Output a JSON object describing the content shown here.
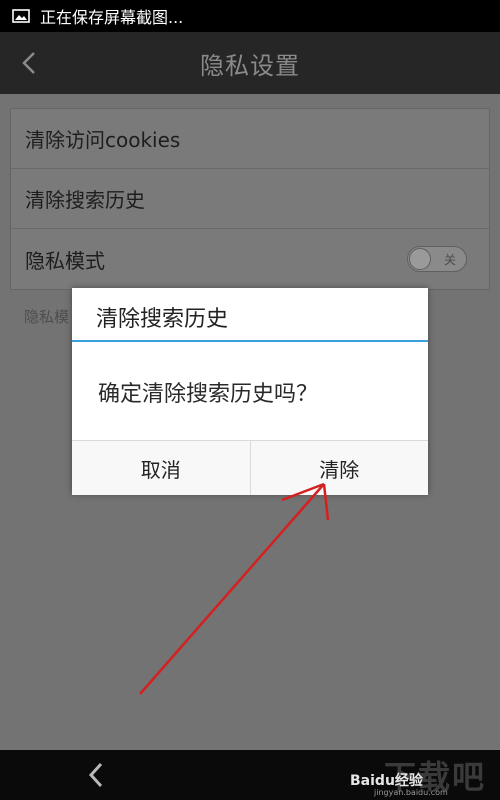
{
  "status_bar": {
    "text": "正在保存屏幕截图...",
    "icon": "image-icon"
  },
  "header": {
    "title": "隐私设置",
    "back_icon": "back-chevron-icon"
  },
  "settings": {
    "items": [
      {
        "label": "清除访问cookies"
      },
      {
        "label": "清除搜索历史"
      },
      {
        "label": "隐私模式",
        "toggle_text": "关",
        "toggle_on": false
      }
    ],
    "hint": "隐私模"
  },
  "dialog": {
    "title": "清除搜索历史",
    "message": "确定清除搜索历史吗？",
    "cancel_label": "取消",
    "confirm_label": "清除",
    "accent_color": "#3aa0dd"
  },
  "annotation": {
    "color": "#d42020",
    "icon": "red-arrow-annotation"
  },
  "watermark": {
    "big": "下载吧",
    "brand": "Baidu经验",
    "sub": "jingyan.baidu.com"
  }
}
